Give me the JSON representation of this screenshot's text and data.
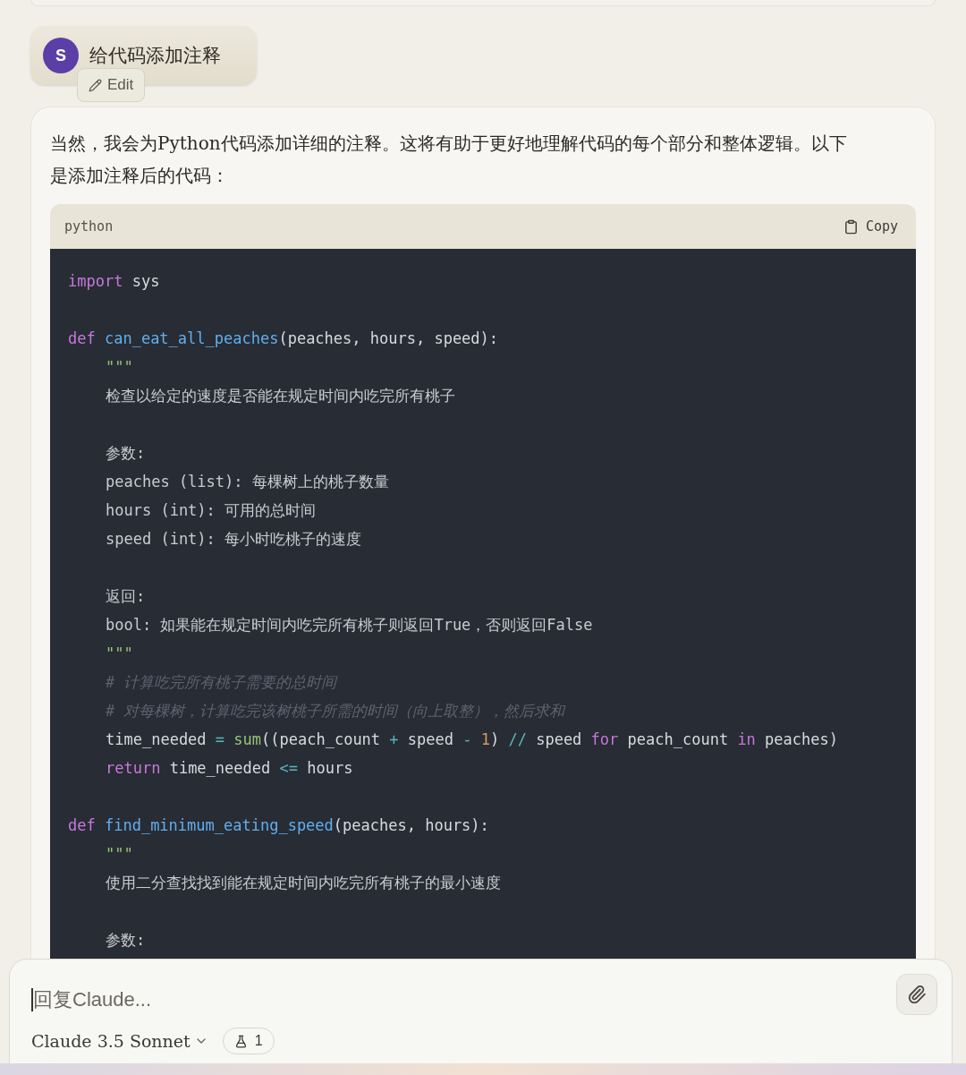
{
  "user_message": {
    "avatar_letter": "S",
    "text": "给代码添加注释",
    "edit_label": "Edit"
  },
  "response": {
    "intro": "当然，我会为Python代码添加详细的注释。这将有助于更好地理解代码的每个部分和整体逻辑。以下是添加注释后的代码：",
    "code_block": {
      "language": "python",
      "copy_label": "Copy",
      "lines": [
        {
          "kind": "code",
          "tokens": [
            {
              "kind": "keyword",
              "text": "import"
            },
            {
              "kind": "plain",
              "text": " sys"
            }
          ]
        },
        {
          "kind": "blank"
        },
        {
          "kind": "code",
          "tokens": [
            {
              "kind": "keyword",
              "text": "def"
            },
            {
              "kind": "function",
              "text": " can_eat_all_peaches"
            },
            {
              "kind": "plain",
              "text": "(peaches, hours, speed):"
            }
          ],
          "children": [
            {
              "kind": "code",
              "tokens": [
                {
                  "kind": "string",
                  "text": "\"\"\""
                }
              ]
            },
            {
              "kind": "code",
              "tokens": [
                {
                  "kind": "doc",
                  "text": "检查以给定的速度是否能在规定时间内吃完所有桃子"
                }
              ]
            },
            {
              "kind": "blank"
            },
            {
              "kind": "code",
              "tokens": [
                {
                  "kind": "doc",
                  "text": "参数:"
                }
              ]
            },
            {
              "kind": "code",
              "tokens": [
                {
                  "kind": "doc",
                  "text": "peaches (list): 每棵树上的桃子数量"
                }
              ]
            },
            {
              "kind": "code",
              "tokens": [
                {
                  "kind": "doc",
                  "text": "hours (int): 可用的总时间"
                }
              ]
            },
            {
              "kind": "code",
              "tokens": [
                {
                  "kind": "doc",
                  "text": "speed (int): 每小时吃桃子的速度"
                }
              ]
            },
            {
              "kind": "blank"
            },
            {
              "kind": "code",
              "tokens": [
                {
                  "kind": "doc",
                  "text": "返回:"
                }
              ]
            },
            {
              "kind": "code",
              "tokens": [
                {
                  "kind": "doc",
                  "text": "bool: 如果能在规定时间内吃完所有桃子则返回True，否则返回False"
                }
              ]
            },
            {
              "kind": "code",
              "tokens": [
                {
                  "kind": "string",
                  "text": "\"\"\""
                }
              ]
            },
            {
              "kind": "code",
              "tokens": [
                {
                  "kind": "comment",
                  "text": "# 计算吃完所有桃子需要的总时间"
                }
              ]
            },
            {
              "kind": "code",
              "tokens": [
                {
                  "kind": "comment",
                  "text": "# 对每棵树，计算吃完该树桃子所需的时间（向上取整），然后求和"
                }
              ]
            },
            {
              "kind": "code",
              "tokens": [
                {
                  "kind": "plain",
                  "text": "time_needed "
                },
                {
                  "kind": "operator",
                  "text": "="
                },
                {
                  "kind": "builtin",
                  "text": " sum"
                },
                {
                  "kind": "plain",
                  "text": "((peach_count "
                },
                {
                  "kind": "operator",
                  "text": "+"
                },
                {
                  "kind": "plain",
                  "text": " speed "
                },
                {
                  "kind": "operator",
                  "text": "-"
                },
                {
                  "kind": "number",
                  "text": " 1"
                },
                {
                  "kind": "plain",
                  "text": ") "
                },
                {
                  "kind": "operator",
                  "text": "//"
                },
                {
                  "kind": "plain",
                  "text": " speed "
                },
                {
                  "kind": "keyword",
                  "text": "for"
                },
                {
                  "kind": "plain",
                  "text": " peach_count "
                },
                {
                  "kind": "keyword",
                  "text": "in"
                },
                {
                  "kind": "plain",
                  "text": " peaches)"
                }
              ]
            },
            {
              "kind": "code",
              "tokens": [
                {
                  "kind": "keyword",
                  "text": "return"
                },
                {
                  "kind": "plain",
                  "text": " time_needed "
                },
                {
                  "kind": "operator",
                  "text": "<="
                },
                {
                  "kind": "plain",
                  "text": " hours"
                }
              ]
            }
          ]
        },
        {
          "kind": "blank"
        },
        {
          "kind": "code",
          "tokens": [
            {
              "kind": "keyword",
              "text": "def"
            },
            {
              "kind": "function",
              "text": " find_minimum_eating_speed"
            },
            {
              "kind": "plain",
              "text": "(peaches, hours):"
            }
          ],
          "children": [
            {
              "kind": "code",
              "tokens": [
                {
                  "kind": "string",
                  "text": "\"\"\""
                }
              ]
            },
            {
              "kind": "code",
              "tokens": [
                {
                  "kind": "doc",
                  "text": "使用二分查找找到能在规定时间内吃完所有桃子的最小速度"
                }
              ]
            },
            {
              "kind": "blank"
            },
            {
              "kind": "code",
              "tokens": [
                {
                  "kind": "doc",
                  "text": "参数:"
                }
              ]
            }
          ]
        }
      ]
    }
  },
  "composer": {
    "placeholder": "回复Claude...",
    "model": "Claude 3.5 Sonnet",
    "badge_count": "1"
  }
}
